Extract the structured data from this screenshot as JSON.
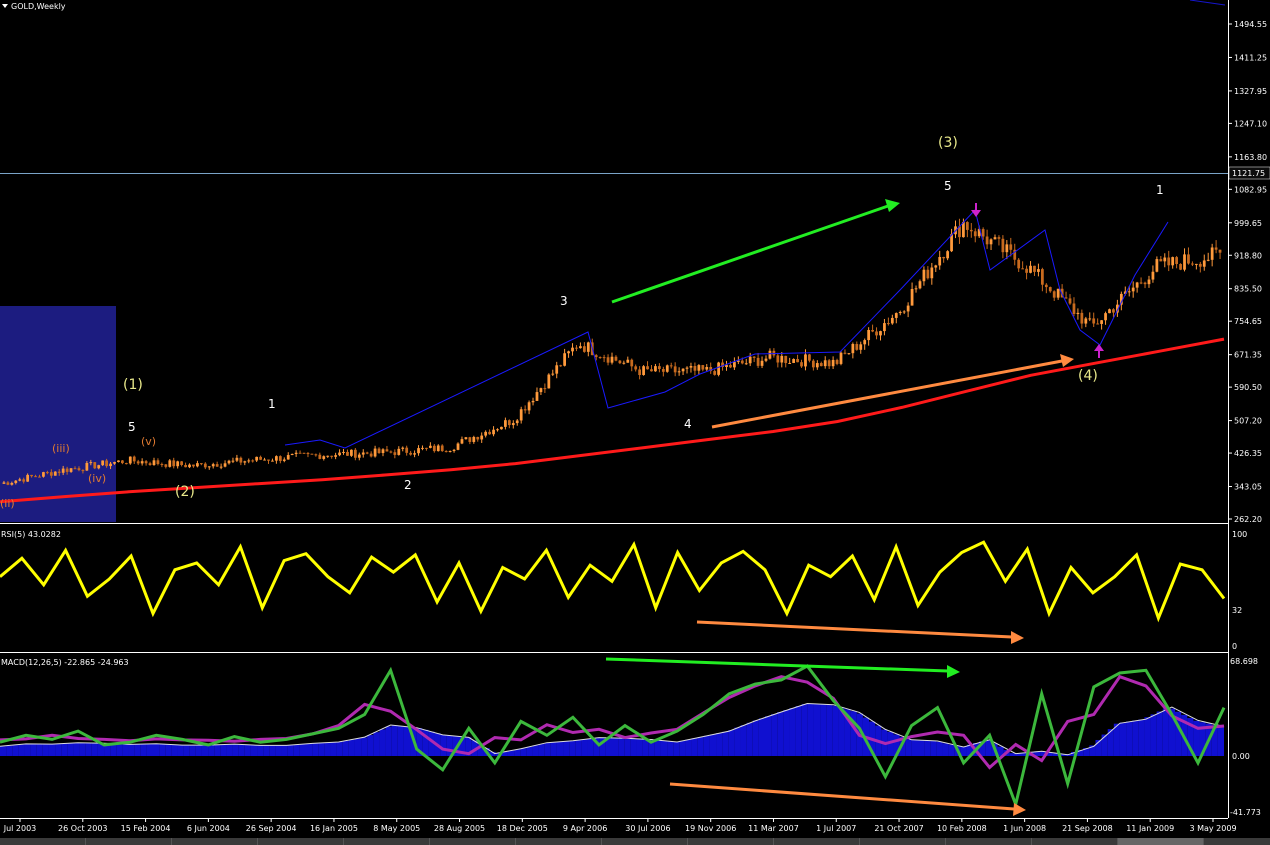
{
  "window": {
    "title": "GOLD,Weekly",
    "menu_icon": "triangle-down-icon"
  },
  "price_axis": {
    "ticks": [
      "1494.55",
      "1411.25",
      "1327.95",
      "1247.10",
      "1163.80",
      "1082.95",
      "999.65",
      "918.80",
      "835.50",
      "754.65",
      "671.35",
      "590.50",
      "507.20",
      "426.35",
      "343.05",
      "262.20"
    ],
    "current_price": "1121.75"
  },
  "rsi": {
    "label": "RSI(5) 43.0282",
    "ticks": [
      "100",
      "32",
      "0"
    ]
  },
  "macd": {
    "label": "MACD(12,26,5) -22.865 -24.963",
    "ticks": [
      "68.698",
      "0.00",
      "-41.773"
    ]
  },
  "time_axis": {
    "labels": [
      "Jul 2003",
      "26 Oct 2003",
      "15 Feb 2004",
      "6 Jun 2004",
      "26 Sep 2004",
      "16 Jan 2005",
      "8 May 2005",
      "28 Aug 2005",
      "18 Dec 2005",
      "9 Apr 2006",
      "30 Jul 2006",
      "19 Nov 2006",
      "11 Mar 2007",
      "1 Jul 2007",
      "21 Oct 2007",
      "10 Feb 2008",
      "1 Jun 2008",
      "21 Sep 2008",
      "11 Jan 2009",
      "3 May 2009"
    ]
  },
  "wave_labels": {
    "w1_big": "(1)",
    "w2_big": "(2)",
    "w3_big": "(3)",
    "w4_big": "(4)",
    "sub_ii": "(ii)",
    "sub_iii": "(iii)",
    "sub_iv": "(iv)",
    "sub_v": "(v)",
    "n5a": "5",
    "n1a": "1",
    "n2": "2",
    "n3": "3",
    "n4": "4",
    "n5b": "5",
    "n1b": "1"
  },
  "colors": {
    "background": "#000000",
    "candle_up": "#ff9a3c",
    "candle_down": "#c86a1e",
    "moving_average": "#ff1a1a",
    "rsi_line": "#ffff00",
    "macd_main": "#b02ab0",
    "macd_signal_fast": "#3cb83c",
    "macd_histogram": "#1010d0",
    "wave_lines": "#1a1aff",
    "arrow_green": "#22ee22",
    "arrow_orange": "#ff8a40",
    "highlight_box": "#1c1c80"
  },
  "chart_data": [
    {
      "type": "candlestick",
      "title": "GOLD,Weekly",
      "x": [
        "Jul 2003",
        "26 Oct 2003",
        "15 Feb 2004",
        "6 Jun 2004",
        "26 Sep 2004",
        "16 Jan 2005",
        "8 May 2005",
        "28 Aug 2005",
        "18 Dec 2005",
        "9 Apr 2006",
        "30 Jul 2006",
        "19 Nov 2006",
        "11 Mar 2007",
        "1 Jul 2007",
        "21 Oct 2007",
        "10 Feb 2008",
        "1 Jun 2008",
        "21 Sep 2008",
        "11 Jan 2009",
        "3 May 2009"
      ],
      "close_approx": [
        350,
        385,
        408,
        395,
        410,
        422,
        428,
        440,
        510,
        700,
        630,
        630,
        665,
        650,
        780,
        1000,
        890,
        740,
        890,
        920
      ],
      "ylim": [
        262.2,
        1530
      ],
      "series": [
        {
          "name": "MA",
          "values": [
            305,
            318,
            330,
            340,
            350,
            360,
            372,
            385,
            400,
            420,
            440,
            460,
            480,
            505,
            540,
            580,
            620,
            650,
            680,
            710
          ]
        }
      ],
      "current_price": 1121.75
    },
    {
      "type": "line",
      "title": "RSI(5) 43.0282",
      "ylim": [
        0,
        100
      ],
      "values": [
        62,
        78,
        55,
        85,
        45,
        60,
        80,
        30,
        68,
        74,
        55,
        88,
        35,
        76,
        82,
        62,
        48,
        79,
        66,
        81,
        40,
        74,
        32,
        70,
        60,
        85,
        44,
        72,
        58,
        90,
        35,
        83,
        50,
        74,
        84,
        68,
        30,
        72,
        62,
        80,
        42,
        88,
        37,
        66,
        83,
        92,
        58,
        86,
        30,
        70,
        48,
        62,
        81,
        26,
        73,
        68,
        43
      ]
    },
    {
      "type": "line",
      "title": "MACD(12,26,5) -22.865 -24.963",
      "ylim": [
        -41.773,
        68.698
      ],
      "values": [
        10,
        15,
        12,
        18,
        8,
        10,
        15,
        12,
        8,
        14,
        10,
        12,
        16,
        20,
        30,
        62,
        5,
        -10,
        20,
        -5,
        25,
        15,
        28,
        8,
        22,
        10,
        18,
        30,
        45,
        52,
        55,
        65,
        40,
        20,
        -15,
        22,
        35,
        -5,
        15,
        -35,
        45,
        -20,
        50,
        60,
        62,
        30,
        -5,
        35
      ]
    }
  ]
}
